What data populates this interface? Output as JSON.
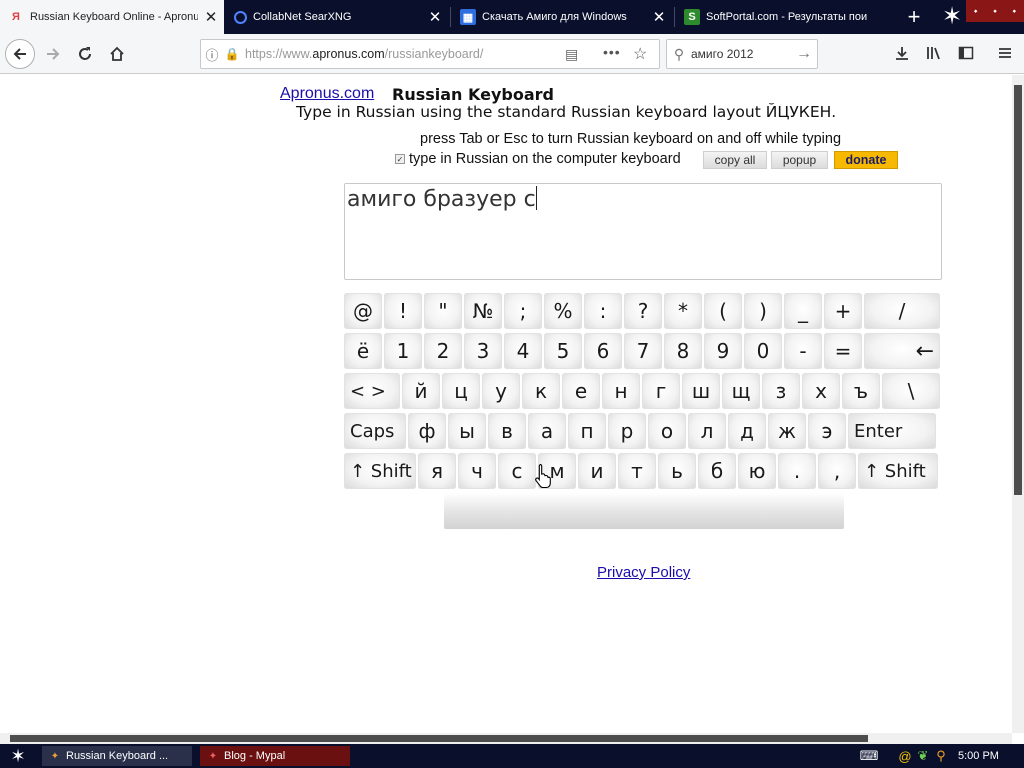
{
  "browser": {
    "tabs": [
      {
        "title": "Russian Keyboard Online - Apronus",
        "favicon": "Я",
        "favicon_color": "#e04040",
        "active": true
      },
      {
        "title": "CollabNet SearXNG",
        "favicon": "Q",
        "favicon_color": "#3b73ff",
        "active": false
      },
      {
        "title": "Скачать Амиго для Windows",
        "favicon": "▦",
        "favicon_color": "#3b73ff",
        "active": false
      },
      {
        "title": "SoftPortal.com - Результаты пои",
        "favicon": "S",
        "favicon_color": "#2d8a2d",
        "active": false
      }
    ],
    "url": {
      "prefix": "https://www.",
      "domain": "apronus.com",
      "path": "/russiankeyboard/"
    },
    "search_value": "амиго  2012"
  },
  "page": {
    "site_link": "Apronus.com",
    "title": "Russian Keyboard",
    "subtitle": "Type in Russian using the standard Russian keyboard layout ЙЦУКЕН.",
    "hint": "press Tab or Esc to turn Russian keyboard on and off while typing",
    "toggle_label": "type in Russian on the computer keyboard",
    "toggle_checked": true,
    "buttons": {
      "copy_all": "copy all",
      "popup": "popup",
      "donate": "donate"
    },
    "editor_text": "амиго бразуер с",
    "privacy": "Privacy Policy"
  },
  "keyboard": {
    "rows": [
      [
        "@",
        "!",
        "\"",
        "№",
        ";",
        "%",
        ":",
        "?",
        "*",
        "(",
        ")",
        "_",
        "+",
        "/"
      ],
      [
        "ё",
        "1",
        "2",
        "3",
        "4",
        "5",
        "6",
        "7",
        "8",
        "9",
        "0",
        "-",
        "=",
        "←"
      ],
      [
        "< >",
        "й",
        "ц",
        "у",
        "к",
        "е",
        "н",
        "г",
        "ш",
        "щ",
        "з",
        "х",
        "ъ",
        "\\"
      ],
      [
        "Caps",
        "ф",
        "ы",
        "в",
        "а",
        "п",
        "р",
        "о",
        "л",
        "д",
        "ж",
        "э",
        "Enter"
      ],
      [
        "↑ Shift",
        "я",
        "ч",
        "с",
        "м",
        "и",
        "т",
        "ь",
        "б",
        "ю",
        ".",
        ",",
        "↑ Shift"
      ]
    ]
  },
  "taskbar": {
    "tasks": [
      {
        "label": "Russian Keyboard ...",
        "icon_color": "#e8a23a"
      },
      {
        "label": "Blog - Mypal",
        "icon_color": "#c83030"
      }
    ],
    "clock": "5:00 PM"
  }
}
